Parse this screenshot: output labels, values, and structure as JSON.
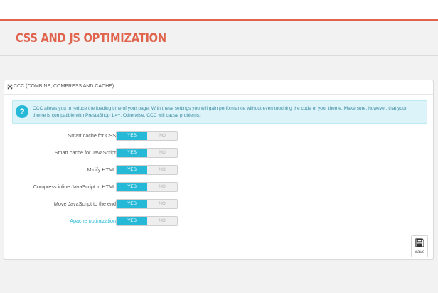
{
  "header": {
    "title": "CSS AND JS OPTIMIZATION"
  },
  "panel": {
    "title": "CCC (COMBINE, COMPRESS AND CACHE)",
    "icon": "expand-arrows-icon"
  },
  "alert": {
    "icon": "question-circle-icon",
    "line1": "CCC allows you to reduce the loading time of your page. With these settings you will gain performance without even touching the code of your theme. Make sure, however, that your",
    "line2": "theme is compatible with PrestaShop 1.4+. Otherwise, CCC will cause problems."
  },
  "settings": [
    {
      "label": "Smart cache for CSS",
      "yes": "YES",
      "no": "NO",
      "value": "YES"
    },
    {
      "label": "Smart cache for JavaScript",
      "yes": "YES",
      "no": "NO",
      "value": "YES"
    },
    {
      "label": "Minify HTML",
      "yes": "YES",
      "no": "NO",
      "value": "YES"
    },
    {
      "label": "Compress inline JavaScript in HTML",
      "yes": "YES",
      "no": "NO",
      "value": "YES"
    },
    {
      "label": "Move JavaScript to the end",
      "yes": "YES",
      "no": "NO",
      "value": "YES"
    },
    {
      "label": "Apache optimization",
      "yes": "YES",
      "no": "NO",
      "value": "YES"
    }
  ],
  "footer": {
    "save_label": "Save",
    "save_icon": "floppy-disk-icon"
  },
  "colors": {
    "accent": "#e0634d",
    "primary": "#25b9d7",
    "alert_bg": "#dcf4f9"
  }
}
